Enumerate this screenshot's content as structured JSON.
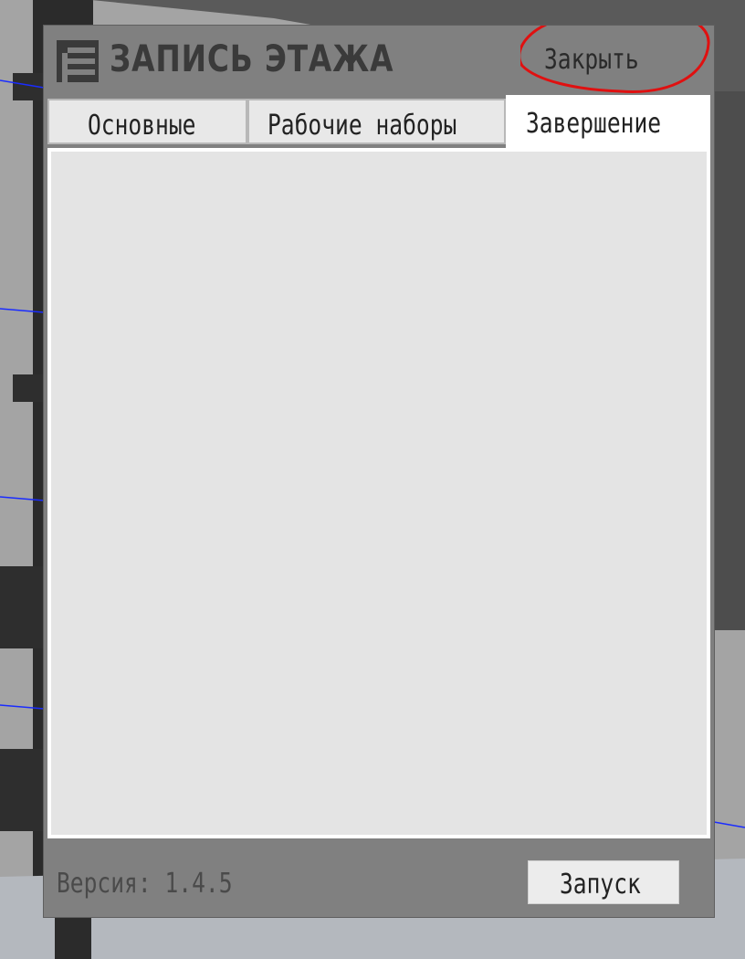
{
  "dialog": {
    "title": "ЗАПИСЬ ЭТАЖА",
    "close_label": "Закрыть",
    "logo_icon": "revit-logo-icon"
  },
  "tabs": [
    {
      "label": "Основные",
      "active": false
    },
    {
      "label": "Рабочие наборы",
      "active": false
    },
    {
      "label": "Завершение",
      "active": true
    }
  ],
  "footer": {
    "version_label": "Версия:",
    "version_value": "1.4.5",
    "run_label": "Запуск"
  },
  "colors": {
    "dialog_bg": "#808080",
    "panel_bg": "#e4e4e4",
    "active_tab_bg": "#ffffff",
    "annotation_red": "#e01010",
    "scene_line_blue": "#1a2cff"
  }
}
